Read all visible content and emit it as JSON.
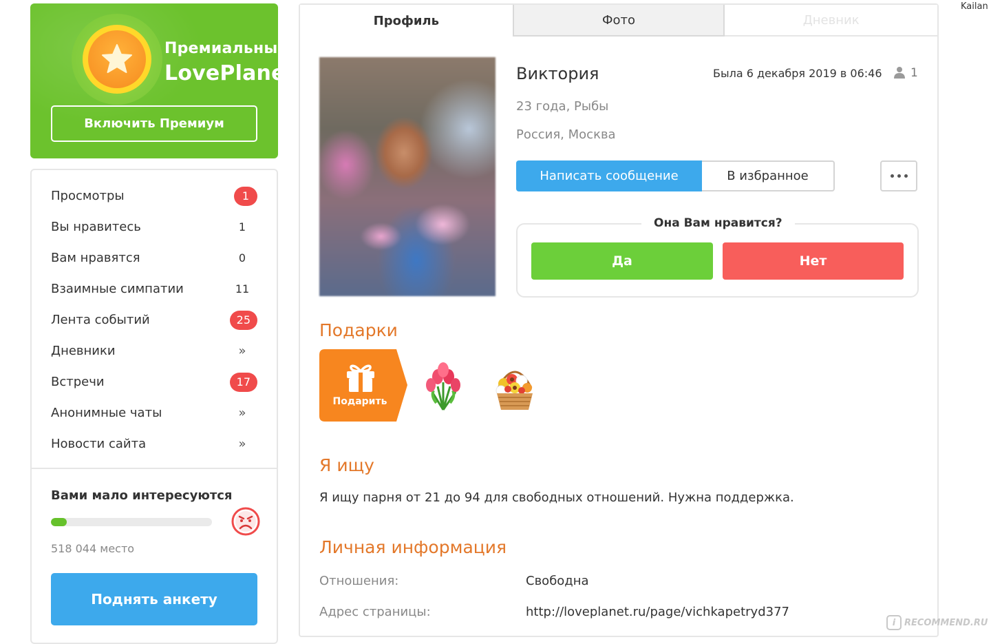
{
  "premium": {
    "title_line1": "Премиальный",
    "title_line2": "LovePlanet",
    "button_label": "Включить Премиум"
  },
  "sidebar": {
    "items": [
      {
        "label": "Просмотры",
        "value": "1",
        "type": "badge"
      },
      {
        "label": "Вы нравитесь",
        "value": "1",
        "type": "count"
      },
      {
        "label": "Вам нравятся",
        "value": "0",
        "type": "count"
      },
      {
        "label": "Взаимные симпатии",
        "value": "11",
        "type": "count"
      },
      {
        "label": "Лента событий",
        "value": "25",
        "type": "badge"
      },
      {
        "label": "Дневники",
        "value": "»",
        "type": "chevron"
      },
      {
        "label": "Встречи",
        "value": "17",
        "type": "badge"
      },
      {
        "label": "Анонимные чаты",
        "value": "»",
        "type": "chevron"
      },
      {
        "label": "Новости сайта",
        "value": "»",
        "type": "chevron"
      }
    ],
    "popularity": {
      "title": "Вами мало интересуются",
      "progress_fraction": 0.1,
      "rank_text": "518 044 место",
      "raise_button": "Поднять анкету"
    }
  },
  "tabs": [
    {
      "label": "Профиль",
      "state": "active"
    },
    {
      "label": "Фото",
      "state": "inactive"
    },
    {
      "label": "Дневник",
      "state": "disabled"
    }
  ],
  "profile": {
    "name": "Виктория",
    "age_sign": "23 года, Рыбы",
    "location": "Россия, Москва",
    "last_seen": "Была 6 декабря 2019 в 06:46",
    "viewers_count": "1",
    "message_button": "Написать сообщение",
    "favorite_button": "В избранное",
    "like_question": "Она Вам нравится?",
    "yes_label": "Да",
    "no_label": "Нет"
  },
  "gifts": {
    "heading": "Подарки",
    "give_label": "Подарить",
    "items": [
      "tulips-bouquet-icon",
      "flower-basket-icon"
    ]
  },
  "seeking": {
    "heading": "Я ищу",
    "text": "Я ищу парня от 21 до 94 для свободных отношений. Нужна поддержка."
  },
  "personal": {
    "heading": "Личная информация",
    "rows": [
      {
        "label": "Отношения:",
        "value": "Свободна"
      },
      {
        "label": "Адрес страницы:",
        "value": "http://loveplanet.ru/page/vichkapetryd377"
      }
    ]
  },
  "user_label": "Kailan",
  "watermark": "RECOMMEND.RU",
  "watermark_badge": "i",
  "colors": {
    "brand_green": "#6cc22d",
    "accent_blue": "#3da9ec",
    "badge_red": "#f04b4b",
    "yes_green": "#6ccf3a",
    "no_red": "#f85e5b",
    "heading_orange": "#e3782a",
    "gift_orange": "#f7861f"
  }
}
